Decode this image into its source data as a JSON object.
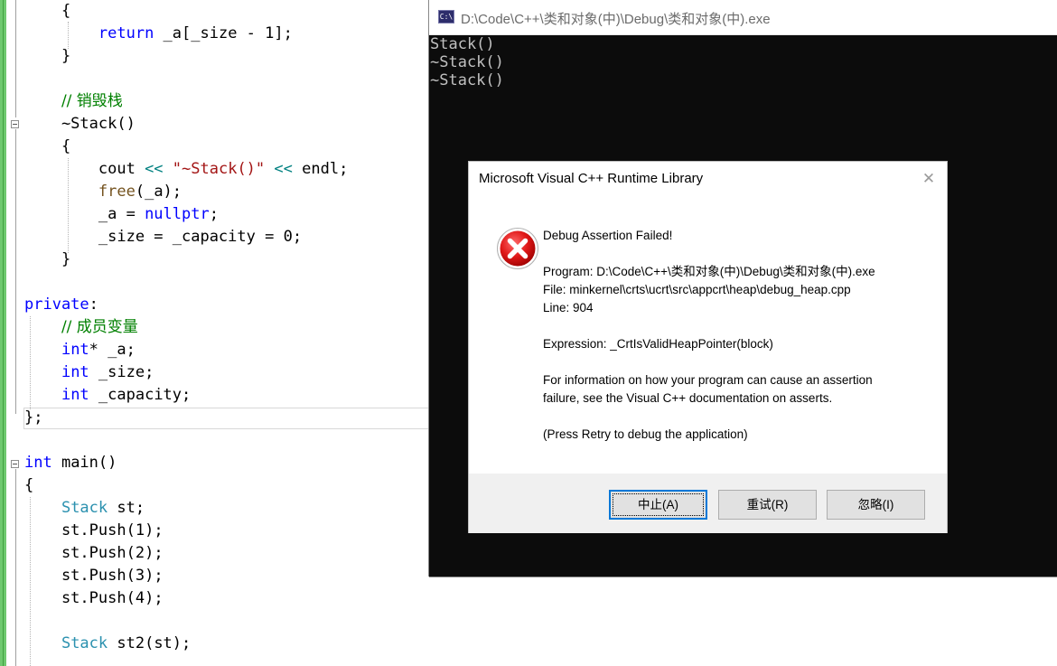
{
  "editor": {
    "lines": [
      [
        {
          "t": "    {",
          "c": ""
        }
      ],
      [
        {
          "t": "        ",
          "c": ""
        },
        {
          "t": "return",
          "c": "kw"
        },
        {
          "t": " _a[_size - ",
          "c": ""
        },
        {
          "t": "1",
          "c": ""
        },
        {
          "t": "];",
          "c": ""
        }
      ],
      [
        {
          "t": "    }",
          "c": ""
        }
      ],
      [
        {
          "t": "",
          "c": ""
        }
      ],
      [
        {
          "t": "    ",
          "c": ""
        },
        {
          "t": "// 销毁栈",
          "c": "com"
        }
      ],
      [
        {
          "t": "    ~Stack()",
          "c": ""
        }
      ],
      [
        {
          "t": "    {",
          "c": ""
        }
      ],
      [
        {
          "t": "        cout ",
          "c": ""
        },
        {
          "t": "<<",
          "c": "op"
        },
        {
          "t": " ",
          "c": ""
        },
        {
          "t": "\"~Stack()\"",
          "c": "str"
        },
        {
          "t": " ",
          "c": ""
        },
        {
          "t": "<<",
          "c": "op"
        },
        {
          "t": " endl;",
          "c": ""
        }
      ],
      [
        {
          "t": "        ",
          "c": ""
        },
        {
          "t": "free",
          "c": "fn"
        },
        {
          "t": "(_a);",
          "c": ""
        }
      ],
      [
        {
          "t": "        _a = ",
          "c": ""
        },
        {
          "t": "nullptr",
          "c": "kw"
        },
        {
          "t": ";",
          "c": ""
        }
      ],
      [
        {
          "t": "        _size = _capacity = ",
          "c": ""
        },
        {
          "t": "0",
          "c": ""
        },
        {
          "t": ";",
          "c": ""
        }
      ],
      [
        {
          "t": "    }",
          "c": ""
        }
      ],
      [
        {
          "t": "",
          "c": ""
        }
      ],
      [
        {
          "t": "private",
          "c": "kw"
        },
        {
          "t": ":",
          "c": ""
        }
      ],
      [
        {
          "t": "    ",
          "c": ""
        },
        {
          "t": "// 成员变量",
          "c": "com"
        }
      ],
      [
        {
          "t": "    ",
          "c": ""
        },
        {
          "t": "int",
          "c": "kw"
        },
        {
          "t": "* _a;",
          "c": ""
        }
      ],
      [
        {
          "t": "    ",
          "c": ""
        },
        {
          "t": "int",
          "c": "kw"
        },
        {
          "t": " _size;",
          "c": ""
        }
      ],
      [
        {
          "t": "    ",
          "c": ""
        },
        {
          "t": "int",
          "c": "kw"
        },
        {
          "t": " _capacity;",
          "c": ""
        }
      ],
      [
        {
          "t": "};",
          "c": ""
        }
      ],
      [
        {
          "t": "",
          "c": ""
        }
      ],
      [
        {
          "t": "int",
          "c": "kw"
        },
        {
          "t": " main()",
          "c": ""
        }
      ],
      [
        {
          "t": "{",
          "c": ""
        }
      ],
      [
        {
          "t": "    ",
          "c": ""
        },
        {
          "t": "Stack",
          "c": "ty"
        },
        {
          "t": " st;",
          "c": ""
        }
      ],
      [
        {
          "t": "    st.Push(",
          "c": ""
        },
        {
          "t": "1",
          "c": ""
        },
        {
          "t": ");",
          "c": ""
        }
      ],
      [
        {
          "t": "    st.Push(",
          "c": ""
        },
        {
          "t": "2",
          "c": ""
        },
        {
          "t": ");",
          "c": ""
        }
      ],
      [
        {
          "t": "    st.Push(",
          "c": ""
        },
        {
          "t": "3",
          "c": ""
        },
        {
          "t": ");",
          "c": ""
        }
      ],
      [
        {
          "t": "    st.Push(",
          "c": ""
        },
        {
          "t": "4",
          "c": ""
        },
        {
          "t": ");",
          "c": ""
        }
      ],
      [
        {
          "t": "",
          "c": ""
        }
      ],
      [
        {
          "t": "    ",
          "c": ""
        },
        {
          "t": "Stack",
          "c": "ty"
        },
        {
          "t": " st2(st);",
          "c": ""
        }
      ]
    ]
  },
  "console": {
    "icon_text": "C:\\",
    "title": "D:\\Code\\C++\\类和对象(中)\\Debug\\类和对象(中).exe",
    "output": [
      "Stack()",
      "~Stack()",
      "~Stack()"
    ]
  },
  "dialog": {
    "title": "Microsoft Visual C++ Runtime Library",
    "close_glyph": "✕",
    "heading": "Debug Assertion Failed!",
    "program": "Program: D:\\Code\\C++\\类和对象(中)\\Debug\\类和对象(中).exe",
    "file": "File: minkernel\\crts\\ucrt\\src\\appcrt\\heap\\debug_heap.cpp",
    "line": "Line: 904",
    "expression": "Expression: _CrtIsValidHeapPointer(block)",
    "info_1": "For information on how your program can cause an assertion",
    "info_2": "failure, see the Visual C++ documentation on asserts.",
    "hint": "(Press Retry to debug the application)",
    "buttons": {
      "abort": "中止(A)",
      "retry": "重试(R)",
      "ignore": "忽略(I)"
    },
    "icon": "error-icon"
  }
}
